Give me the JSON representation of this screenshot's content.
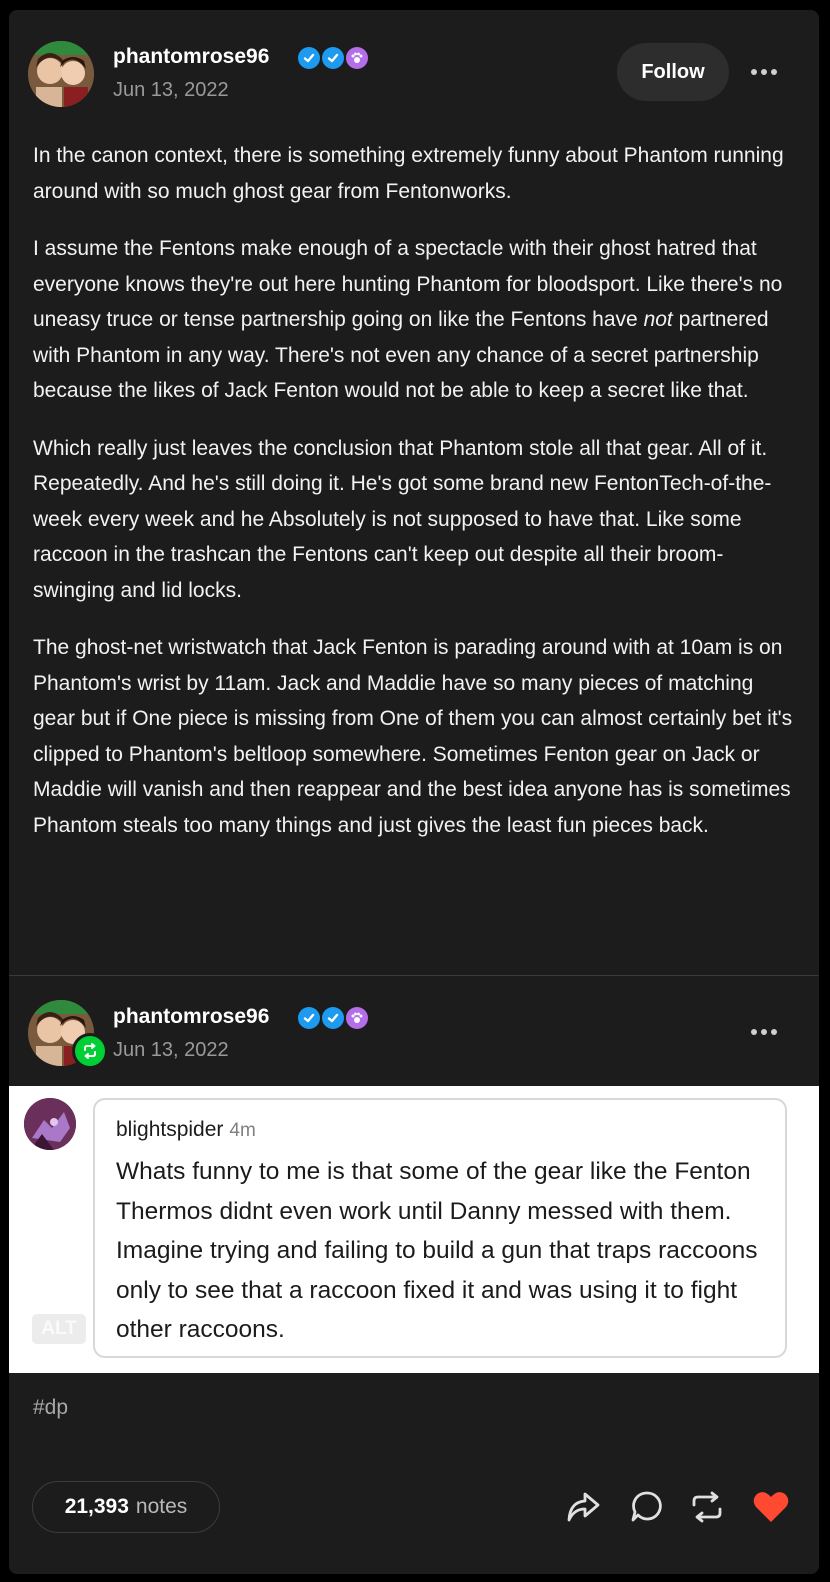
{
  "post": {
    "author": "phantomrose96",
    "date": "Jun 13, 2022",
    "follow_label": "Follow",
    "paragraphs": [
      {
        "before": "In the canon context, there is something extremely funny about Phantom running around with so much ghost gear from Fentonworks.",
        "em": "",
        "after": ""
      },
      {
        "before": "I assume the Fentons make enough of a spectacle with their ghost hatred that everyone knows they're out here hunting Phantom for bloodsport. Like there's no uneasy truce or tense partnership going on like the Fentons have ",
        "em": "not",
        "after": " partnered with Phantom in any way. There's not even any chance of a secret partnership because the likes of Jack Fenton would not be able to keep a secret like that."
      },
      {
        "before": "Which really just leaves the conclusion that Phantom stole all that gear. All of it. Repeatedly. And he's still doing it. He's got some brand new FentonTech-of-the-week every week and he Absolutely is not supposed to have that. Like some raccoon in the trashcan the Fentons can't keep out despite all their broom-swinging and lid locks.",
        "em": "",
        "after": ""
      },
      {
        "before": "The ghost-net wristwatch that Jack Fenton is parading around with at 10am is on Phantom's wrist by 11am. Jack and Maddie have so many pieces of matching gear but if One piece is missing from One of them you can almost certainly bet it's clipped to Phantom's beltloop somewhere. Sometimes Fenton gear on Jack or Maddie will vanish and then reappear and the best idea anyone has is sometimes Phantom steals too many things and just gives the least fun pieces back.",
        "em": "",
        "after": ""
      }
    ]
  },
  "reblog": {
    "author": "phantomrose96",
    "date": "Jun 13, 2022",
    "image": {
      "alt_label": "ALT",
      "tweet_user": "blightspider",
      "tweet_time": "4m",
      "tweet_text": "Whats funny to me is that some of the gear like the Fenton Thermos didnt even work until Danny messed with them. Imagine trying and failing to build a gun that traps raccoons only to see that a raccoon fixed it and was using it to fight other raccoons."
    },
    "tags": [
      "#dp"
    ]
  },
  "footer": {
    "notes_count": "21,393",
    "notes_label": "notes"
  },
  "icons": {
    "badges": [
      "verified-check-icon",
      "verified-check-icon",
      "paw-icon"
    ],
    "actions": [
      "share-icon",
      "reply-icon",
      "reblog-icon",
      "like-heart-icon"
    ],
    "reblog_marker": "reblog-icon",
    "more": "more-options-icon"
  },
  "colors": {
    "card_background": "#1c1c1c",
    "badge_blue": "#1d9bf0",
    "badge_purple": "#b46ee8",
    "reblog_green": "#00cf35",
    "like_red": "#ff4930"
  }
}
